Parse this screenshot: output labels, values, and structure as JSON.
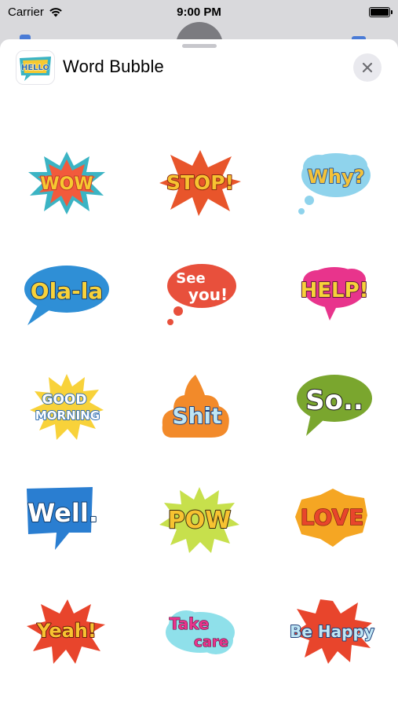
{
  "status_bar": {
    "carrier": "Carrier",
    "time": "9:00 PM"
  },
  "header": {
    "app_icon_text": "HELLO",
    "title": "Word Bubble"
  },
  "stickers": [
    {
      "label": "WOW",
      "name": "sticker-wow",
      "colors": {
        "burst": "#f25a3c",
        "text": "#f6c930",
        "accent": "#3bb4c4"
      }
    },
    {
      "label": "STOP!",
      "name": "sticker-stop",
      "colors": {
        "burst": "#e8552b",
        "text": "#f7c331"
      }
    },
    {
      "label": "Why?",
      "name": "sticker-why",
      "colors": {
        "cloud": "#8fd3ec",
        "text": "#f3c23a"
      }
    },
    {
      "label": "Ola-la",
      "name": "sticker-ola-la",
      "colors": {
        "bubble": "#2f8fd6",
        "text": "#f8d23a"
      }
    },
    {
      "label": "See",
      "label2": "you!",
      "name": "sticker-see-you",
      "colors": {
        "bubble": "#e8503c",
        "text": "#ffffff"
      }
    },
    {
      "label": "HELP!",
      "name": "sticker-help",
      "colors": {
        "bubble": "#e8348c",
        "text": "#f7d23a"
      }
    },
    {
      "label": "GOOD",
      "label2": "MORNING",
      "name": "sticker-good-morning",
      "colors": {
        "burst": "#f8d23a",
        "text": "#ffffff",
        "outline": "#2f6db0"
      }
    },
    {
      "label": "Shit",
      "name": "sticker-shit",
      "colors": {
        "shape": "#f28a2a",
        "text": "#bfe6f4",
        "outline": "#1f3f7a"
      }
    },
    {
      "label": "So..",
      "name": "sticker-so",
      "colors": {
        "bubble": "#7aa62e",
        "text": "#ffffff"
      }
    },
    {
      "label": "Well.",
      "name": "sticker-well",
      "colors": {
        "bubble": "#2a7ed1",
        "text": "#ffffff"
      }
    },
    {
      "label": "POW",
      "name": "sticker-pow",
      "colors": {
        "burst": "#c7e04c",
        "text": "#f7c331"
      }
    },
    {
      "label": "LOVE",
      "name": "sticker-love",
      "colors": {
        "cloud": "#f5a623",
        "text": "#e8452c"
      }
    },
    {
      "label": "Yeah!",
      "name": "sticker-yeah",
      "colors": {
        "burst": "#e8452c",
        "text": "#f7c331"
      }
    },
    {
      "label": "Take",
      "label2": "care",
      "name": "sticker-take-care",
      "colors": {
        "cloud": "#8fe0ea",
        "text": "#e8348c"
      }
    },
    {
      "label": "Be Happy",
      "name": "sticker-be-happy",
      "colors": {
        "burst": "#e8452c",
        "text": "#bfe6f4"
      }
    }
  ]
}
